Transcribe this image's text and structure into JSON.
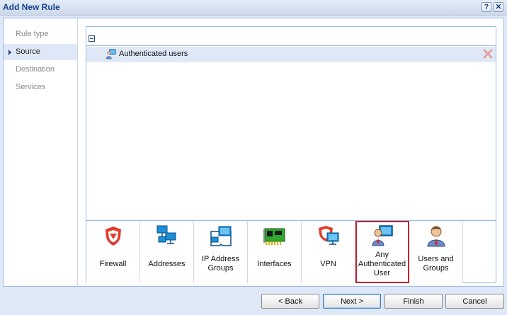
{
  "window": {
    "title": "Add New Rule",
    "help_glyph": "?",
    "close_glyph": "✕"
  },
  "nav": {
    "items": [
      {
        "label": "Rule type",
        "active": false
      },
      {
        "label": "Source",
        "active": true
      },
      {
        "label": "Destination",
        "active": false
      },
      {
        "label": "Services",
        "active": false
      }
    ]
  },
  "tree": {
    "rows": [
      {
        "label": "Authenticated users",
        "icon": "authenticated-user-icon"
      }
    ]
  },
  "tray": {
    "tiles": [
      {
        "label": "Firewall",
        "icon": "firewall-shield-icon",
        "selected": false
      },
      {
        "label": "Addresses",
        "icon": "network-computers-icon",
        "selected": false
      },
      {
        "label": "IP Address Groups",
        "icon": "ip-address-groups-icon",
        "selected": false
      },
      {
        "label": "Interfaces",
        "icon": "network-interface-card-icon",
        "selected": false
      },
      {
        "label": "VPN",
        "icon": "vpn-icon",
        "selected": false
      },
      {
        "label": "Any Authenticated User",
        "icon": "authenticated-user-icon",
        "selected": true
      },
      {
        "label": "Users and Groups",
        "icon": "user-icon",
        "selected": false
      }
    ]
  },
  "buttons": {
    "back": "< Back",
    "next": "Next >",
    "finish": "Finish",
    "cancel": "Cancel"
  },
  "colors": {
    "selected_outline": "#c8202a",
    "nav_active_bg": "#dfe8f6",
    "title_text": "#15428b"
  }
}
